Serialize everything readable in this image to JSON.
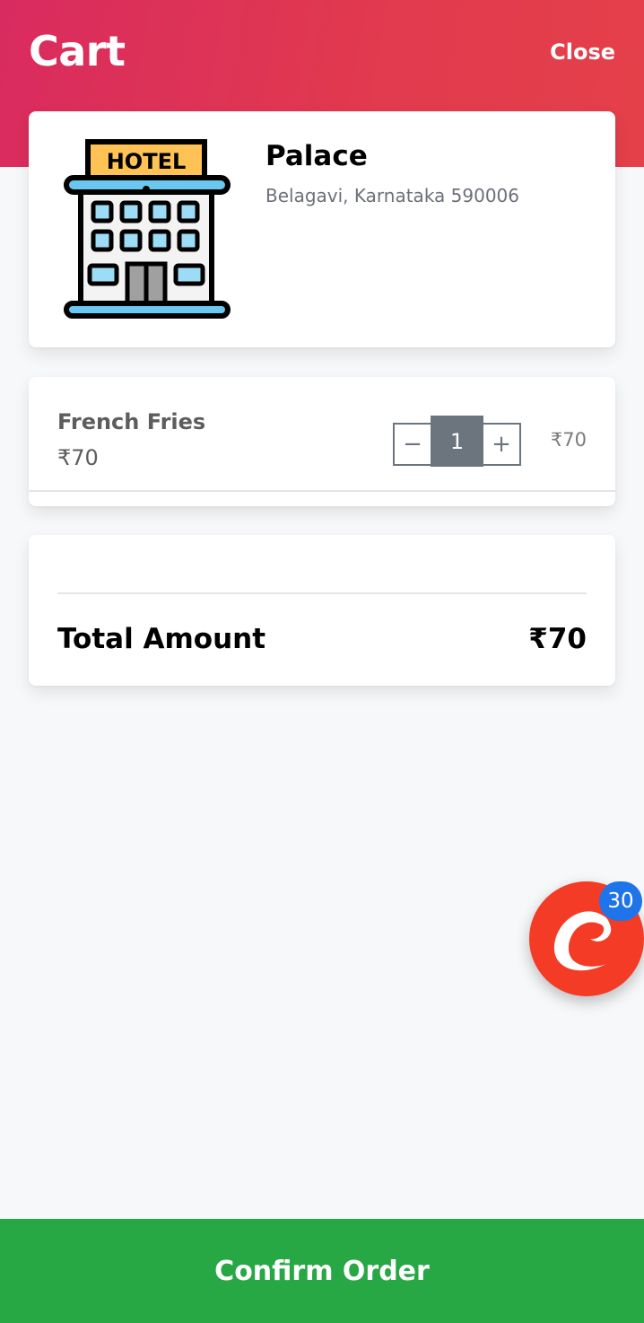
{
  "header": {
    "title": "Cart",
    "close_label": "Close"
  },
  "restaurant": {
    "name": "Palace",
    "address": "Belagavi, Karnataka 590006",
    "image_sign_text": "HOTEL",
    "image_icon": "hotel-building-icon"
  },
  "cart_items": [
    {
      "name": "French Fries",
      "unit_price": "₹70",
      "quantity": "1",
      "line_total": "₹70",
      "decrement_symbol": "−",
      "increment_symbol": "+"
    }
  ],
  "summary": {
    "total_label": "Total Amount",
    "total_value": "₹70"
  },
  "fab": {
    "icon": "coupon-c-icon",
    "badge_count": "30"
  },
  "footer": {
    "confirm_label": "Confirm Order"
  },
  "colors": {
    "header_gradient_start": "#d92b5f",
    "header_gradient_end": "#e4404a",
    "confirm_button": "#28a745",
    "fab": "#f43b25",
    "badge": "#1e74e8",
    "stepper": "#6c757d"
  }
}
